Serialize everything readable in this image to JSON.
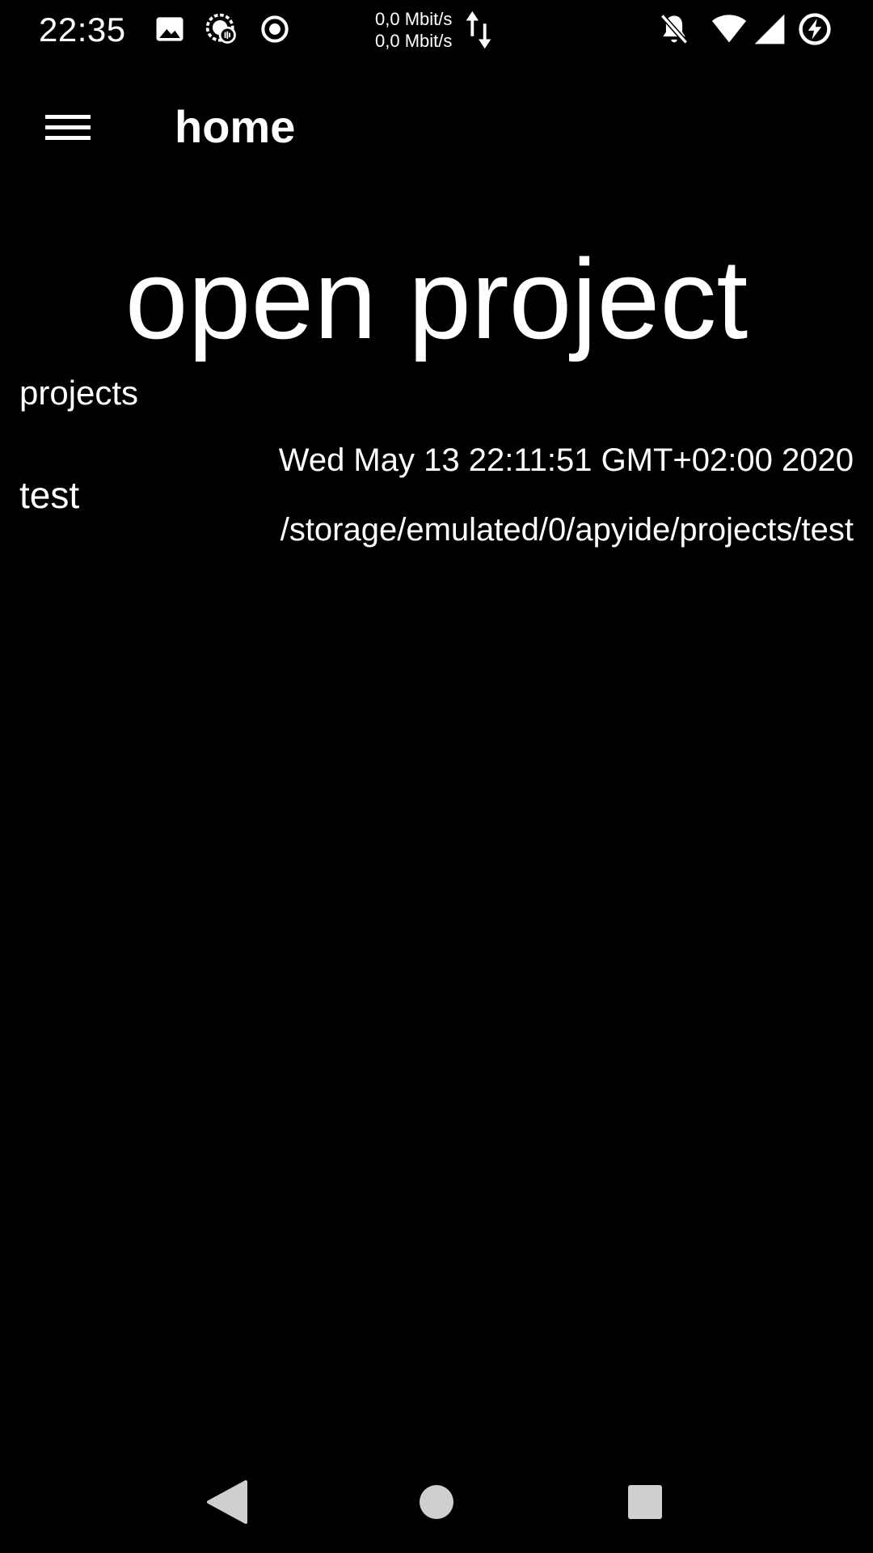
{
  "status_bar": {
    "time": "22:35",
    "net_up": "0,0 Mbit/s",
    "net_down": "0,0 Mbit/s",
    "icons": [
      "image-icon",
      "app-notification-icon",
      "record-icon",
      "data-transfer-icon",
      "notifications-off-icon",
      "wifi-icon",
      "cellular-signal-icon",
      "battery-charging-icon"
    ]
  },
  "toolbar": {
    "menu_icon": "hamburger-menu-icon",
    "title": "home"
  },
  "main": {
    "heading": "open project",
    "section_label": "projects",
    "projects": [
      {
        "name": "test",
        "date": "Wed May 13 22:11:51 GMT+02:00 2020",
        "path": "/storage/emulated/0/apyide/projects/test"
      }
    ]
  },
  "nav_bar": {
    "icons": [
      "back-icon",
      "home-icon",
      "recents-icon"
    ]
  },
  "colors": {
    "background": "#000000",
    "foreground": "#ffffff",
    "nav_icon": "#cfcfcf"
  }
}
